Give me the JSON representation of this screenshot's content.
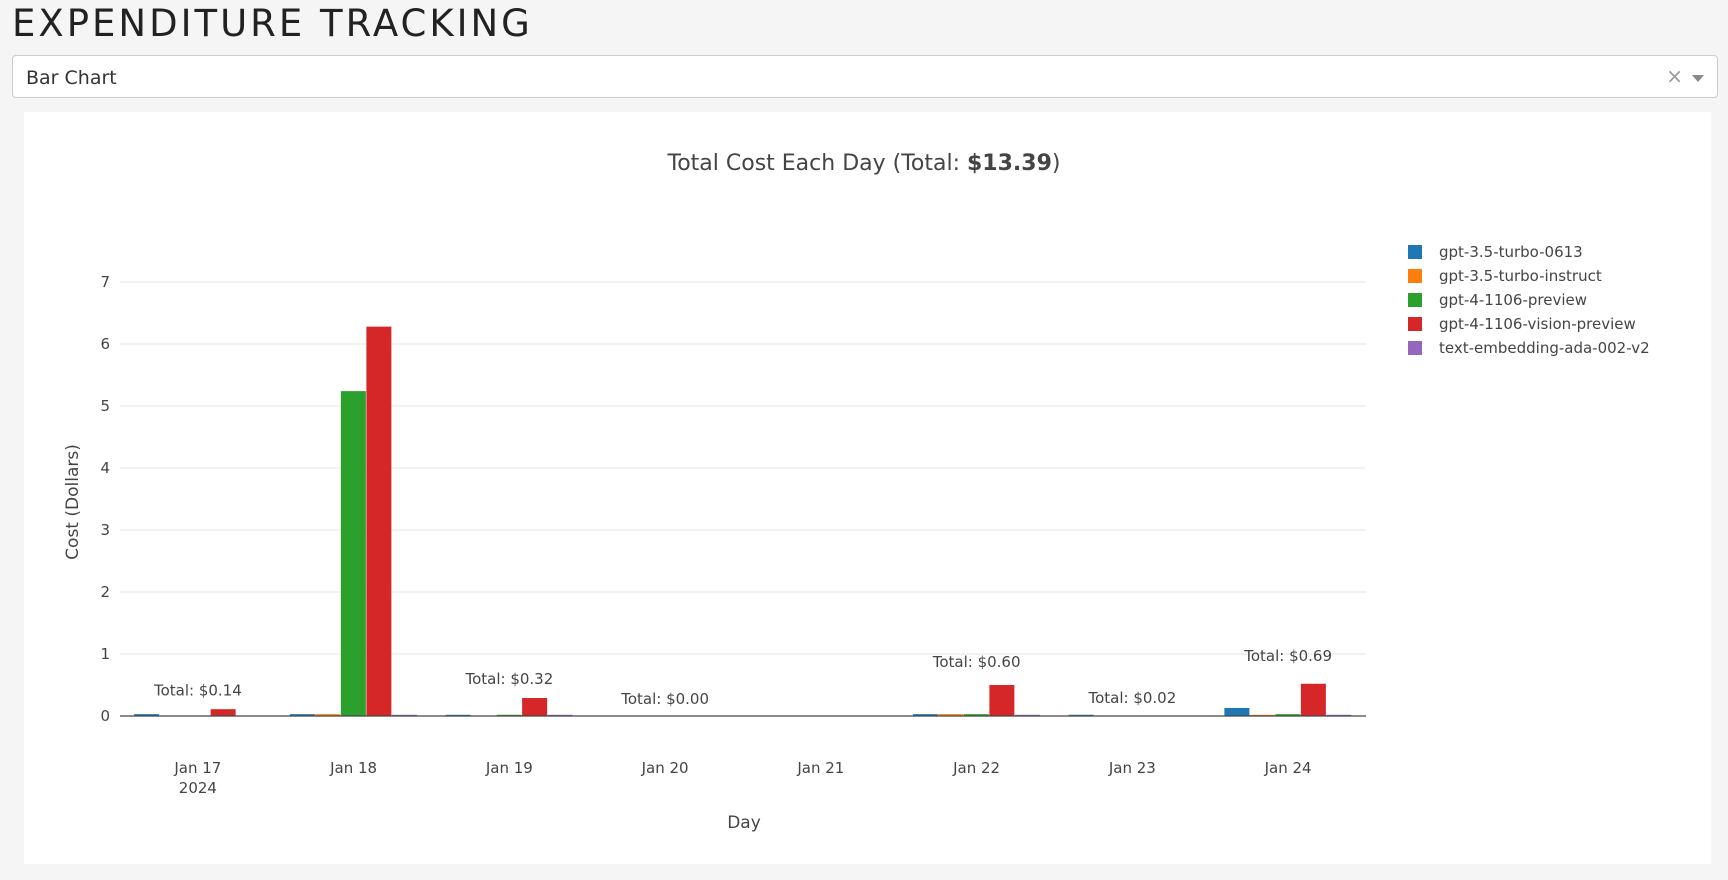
{
  "header": {
    "title": "EXPENDITURE TRACKING"
  },
  "chart_selector": {
    "selected": "Bar Chart",
    "clear_glyph": "×"
  },
  "chart_data": {
    "type": "bar",
    "title_prefix": "Total Cost Each Day (Total: ",
    "title_total": "$13.39",
    "title_suffix": ")",
    "xlabel": "Day",
    "ylabel": "Cost (Dollars)",
    "ylim": [
      0,
      7.5
    ],
    "yticks": [
      0,
      1,
      2,
      3,
      4,
      5,
      6,
      7
    ],
    "grid": true,
    "legend_position": "top-right",
    "categories": [
      "Jan 17",
      "Jan 18",
      "Jan 19",
      "Jan 20",
      "Jan 21",
      "Jan 22",
      "Jan 23",
      "Jan 24"
    ],
    "category_sublabels": [
      "2024",
      "",
      "",
      "",
      "",
      "",
      "",
      ""
    ],
    "series": [
      {
        "name": "gpt-3.5-turbo-0613",
        "color": "#1f77b4",
        "values": [
          0.03,
          0.03,
          0.005,
          0,
          0,
          0.03,
          0.02,
          0.13
        ]
      },
      {
        "name": "gpt-3.5-turbo-instruct",
        "color": "#ff7f0e",
        "values": [
          0,
          0.03,
          0,
          0,
          0,
          0.03,
          0,
          0.01
        ]
      },
      {
        "name": "gpt-4-1106-preview",
        "color": "#2ca02c",
        "values": [
          0,
          5.24,
          0.02,
          0,
          0,
          0.03,
          0,
          0.03
        ]
      },
      {
        "name": "gpt-4-1106-vision-preview",
        "color": "#d62728",
        "values": [
          0.11,
          6.28,
          0.29,
          0,
          0,
          0.5,
          0,
          0.52
        ]
      },
      {
        "name": "text-embedding-ada-002-v2",
        "color": "#9467bd",
        "values": [
          0,
          0.005,
          0.005,
          0,
          0,
          0.005,
          0,
          0.005
        ]
      }
    ],
    "annotations": [
      {
        "category": "Jan 17",
        "text": "Total: $0.14",
        "y": 0.14
      },
      {
        "category": "Jan 19",
        "text": "Total: $0.32",
        "y": 0.32
      },
      {
        "category": "Jan 20",
        "text": "Total: $0.00",
        "y": 0.0
      },
      {
        "category": "Jan 22",
        "text": "Total: $0.60",
        "y": 0.6
      },
      {
        "category": "Jan 23",
        "text": "Total: $0.02",
        "y": 0.02
      },
      {
        "category": "Jan 24",
        "text": "Total: $0.69",
        "y": 0.69
      }
    ]
  }
}
